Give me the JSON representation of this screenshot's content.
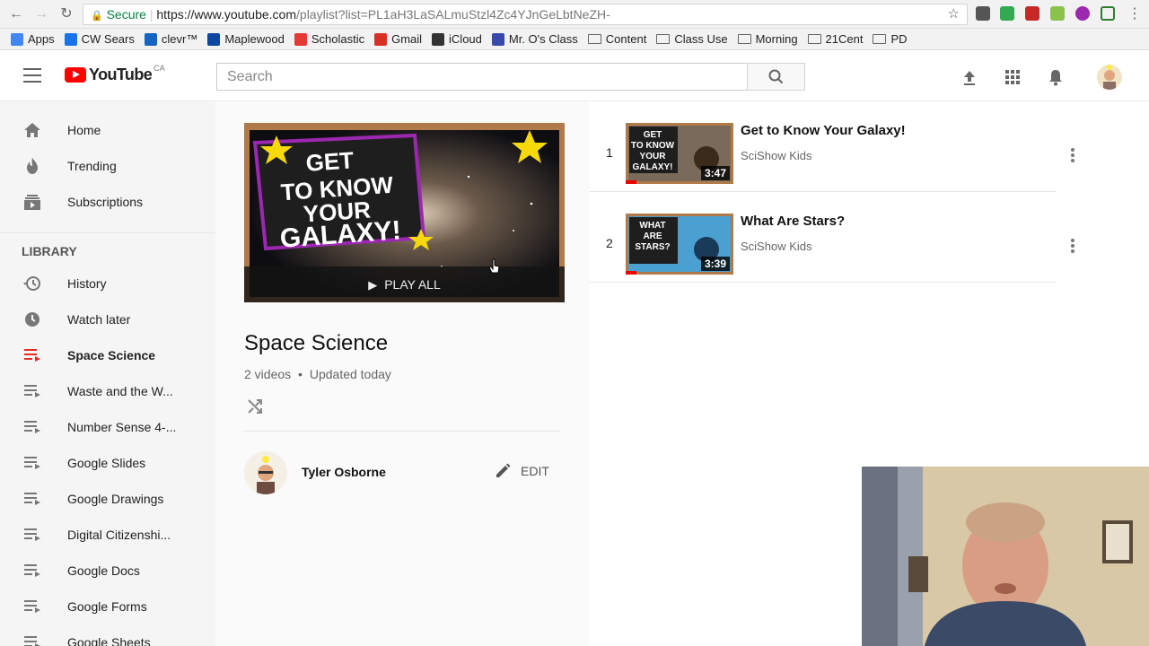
{
  "browser": {
    "secure_label": "Secure",
    "url_host": "https://www.youtube.com",
    "url_path": "/playlist?list=PL1aH3LaSALmuStzl4Zc4YJnGeLbtNeZH-"
  },
  "bookmarks": [
    {
      "label": "Apps",
      "icon": "apps-grid-icon",
      "color": "#4285f4"
    },
    {
      "label": "CW Sears",
      "icon": "cw-sears-icon",
      "color": "#1a73e8"
    },
    {
      "label": "clevr™",
      "icon": "clever-icon",
      "color": "#1565c0"
    },
    {
      "label": "Maplewood",
      "icon": "maplewood-icon",
      "color": "#0d47a1"
    },
    {
      "label": "Scholastic",
      "icon": "scholastic-icon",
      "color": "#e53935"
    },
    {
      "label": "Gmail",
      "icon": "gmail-icon",
      "color": "#d93025"
    },
    {
      "label": "iCloud",
      "icon": "apple-icon",
      "color": "#333333"
    },
    {
      "label": "Mr. O's Class",
      "icon": "class-site-icon",
      "color": "#3949ab"
    },
    {
      "label": "Content",
      "icon": "folder-icon",
      "color": "#666666"
    },
    {
      "label": "Class Use",
      "icon": "folder-icon",
      "color": "#666666"
    },
    {
      "label": "Morning",
      "icon": "folder-icon",
      "color": "#666666"
    },
    {
      "label": "21Cent",
      "icon": "folder-icon",
      "color": "#666666"
    },
    {
      "label": "PD",
      "icon": "folder-icon",
      "color": "#666666"
    }
  ],
  "header": {
    "logo_text": "YouTube",
    "logo_region": "CA",
    "search_placeholder": "Search"
  },
  "sidebar": {
    "top_items": [
      {
        "label": "Home",
        "icon": "home-icon"
      },
      {
        "label": "Trending",
        "icon": "trending-flame-icon"
      },
      {
        "label": "Subscriptions",
        "icon": "subscriptions-icon"
      }
    ],
    "library_heading": "LIBRARY",
    "library_items": [
      {
        "label": "History",
        "icon": "history-icon",
        "active": false
      },
      {
        "label": "Watch later",
        "icon": "watch-later-icon",
        "active": false
      },
      {
        "label": "Space Science",
        "icon": "playlist-icon",
        "active": true
      },
      {
        "label": "Waste and the W...",
        "icon": "playlist-icon",
        "active": false
      },
      {
        "label": "Number Sense 4-...",
        "icon": "playlist-icon",
        "active": false
      },
      {
        "label": "Google Slides",
        "icon": "playlist-icon",
        "active": false
      },
      {
        "label": "Google Drawings",
        "icon": "playlist-icon",
        "active": false
      },
      {
        "label": "Digital Citizenshi...",
        "icon": "playlist-icon",
        "active": false
      },
      {
        "label": "Google Docs",
        "icon": "playlist-icon",
        "active": false
      },
      {
        "label": "Google Forms",
        "icon": "playlist-icon",
        "active": false
      },
      {
        "label": "Google Sheets",
        "icon": "playlist-icon",
        "active": false
      }
    ]
  },
  "playlist": {
    "hero_text": "GET TO KNOW YOUR GALAXY!",
    "play_all_label": "PLAY ALL",
    "title": "Space Science",
    "video_count": "2 videos",
    "separator": "•",
    "updated": "Updated today",
    "owner_name": "Tyler Osborne",
    "edit_label": "EDIT"
  },
  "videos": [
    {
      "index": "1",
      "title": "Get to Know Your Galaxy!",
      "channel": "SciShow Kids",
      "duration": "3:47",
      "thumb_text": "GET TO KNOW YOUR GALAXY!"
    },
    {
      "index": "2",
      "title": "What Are Stars?",
      "channel": "SciShow Kids",
      "duration": "3:39",
      "thumb_text": "WHAT ARE STARS?"
    }
  ],
  "colors": {
    "brand_red": "#ff0000",
    "active_playlist": "#e52d27",
    "secure_green": "#0b8043"
  }
}
